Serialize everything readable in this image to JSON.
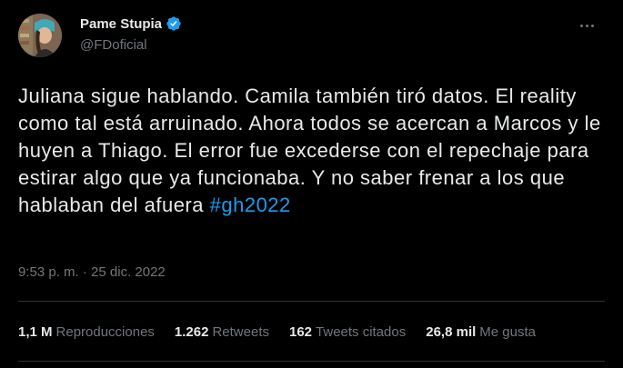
{
  "author": {
    "display_name": "Pame Stupia",
    "handle": "@FDoficial",
    "verified": true
  },
  "tweet": {
    "text": "Juliana sigue hablando. Camila también tiró datos. El reality como tal está arruinado. Ahora todos se acercan a Marcos y le huyen a Thiago. El error fue excederse con el repechaje para estirar algo que ya funcionaba. Y no saber frenar a los que hablaban del afuera ",
    "hashtag": "#gh2022",
    "time": "9:53 p. m.",
    "separator": "·",
    "date": "25 dic. 2022"
  },
  "stats": {
    "views": {
      "value": "1,1 M",
      "label": "Reproducciones"
    },
    "retweets": {
      "value": "1.262",
      "label": "Retweets"
    },
    "quotes": {
      "value": "162",
      "label": "Tweets citados"
    },
    "likes": {
      "value": "26,8 mil",
      "label": "Me gusta"
    }
  },
  "colors": {
    "background": "#000000",
    "text": "#e7e9ea",
    "secondary": "#71767b",
    "accent": "#1d9bf0",
    "divider": "#2f3336"
  },
  "icons": {
    "verified": "verified-badge-icon",
    "more": "more-options-icon"
  }
}
